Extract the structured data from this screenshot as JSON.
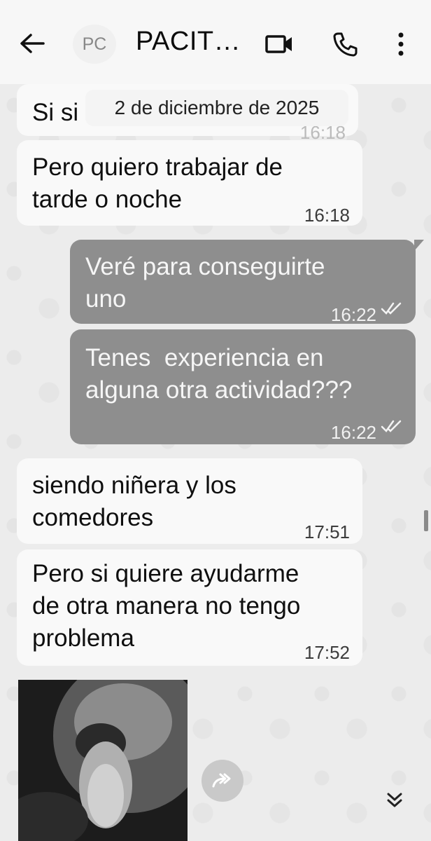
{
  "header": {
    "back_icon": "arrow-left-icon",
    "avatar_initials": "PC",
    "contact_name": "PACIT…",
    "video_icon": "video-camera-icon",
    "call_icon": "phone-icon",
    "menu_icon": "more-vertical-icon"
  },
  "chat": {
    "date_separator": "2 de diciembre de 2025",
    "partial_message": {
      "text": "Si si",
      "time": "16:18"
    },
    "messages": [
      {
        "direction": "in",
        "text": "Pero quiero trabajar de\ntarde o noche",
        "time": "16:18"
      },
      {
        "direction": "out",
        "text": "Veré para conseguirte\nuno",
        "time": "16:22",
        "status": "read"
      },
      {
        "direction": "out",
        "text": "Tenes  experiencia en\nalguna otra actividad???",
        "time": "16:22",
        "status": "read"
      },
      {
        "direction": "in",
        "text": "siendo niñera y los\ncomedores",
        "time": "17:51"
      },
      {
        "direction": "in",
        "text": "Pero si quiere ayudarme\nde otra manera no tengo\nproblema",
        "time": "17:52"
      }
    ],
    "photo_icon": "image-photo",
    "forward_icon": "forward-icon",
    "scroll_down_icon": "double-chevron-down-icon"
  },
  "colors": {
    "incoming_bubble": "#f9f9f9",
    "outgoing_bubble": "#8e8e8e",
    "header_bg": "#f7f7f7",
    "wallpaper": "#ececec"
  }
}
